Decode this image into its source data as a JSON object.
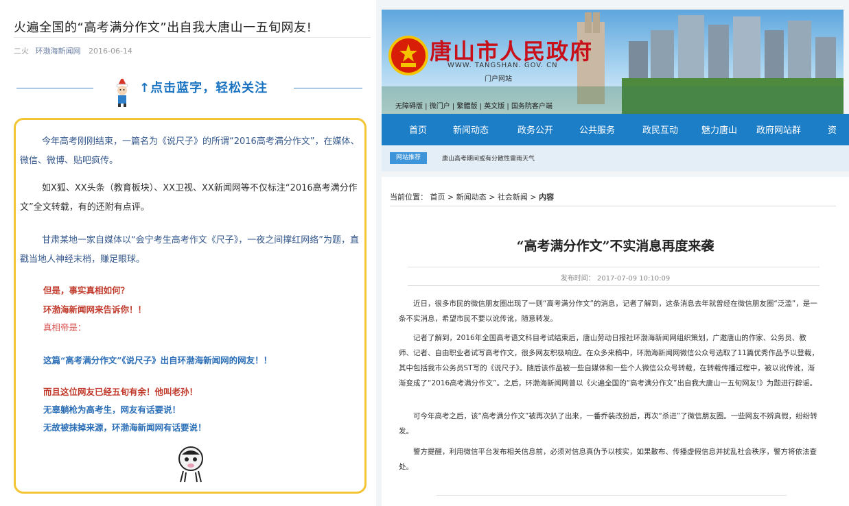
{
  "left": {
    "title": "火遍全国的“高考满分作文”出自我大唐山一五旬网友!",
    "meta": {
      "author": "二火",
      "source": "环渤海新闻网",
      "date": "2016-06-14"
    },
    "follow_text": "↑点击蓝字，轻松关注",
    "paragraphs": [
      "今年高考刚刚结束，一篇名为《说尺子》的所谓“2016高考满分作文”，在媒体、微信、微博、贴吧疯传。",
      "如X狐、XX头条（教育板块）、XX卫视、XX新闻网等不仅标注“2016高考满分作文”全文转载，有的还附有点评。",
      "甘肃某地一家自媒体以“会宁考生高考作文《尺子》，一夜之间撑红网络”为题，直戳当地人神经末梢，赚足眼球。"
    ],
    "red_lines": [
      "但是，事实真相如何？",
      "环渤海新闻网来告诉你！！",
      "真相帝是："
    ],
    "blue_line": "这篇“高考满分作文”《说尺子》出自环渤海新闻网的网友！！",
    "closing_lines": [
      "而且这位网友已经五旬有余！他叫老孙！",
      "无辜躺枪为高考生，网友有话要说！",
      "无故被抹掉来源，环渤海新闻网有话要说！"
    ],
    "colors": {
      "border": "#f3c433",
      "blue_text": "#35588c",
      "red_text": "#c0392b"
    }
  },
  "right": {
    "site_title": "唐山市人民政府",
    "site_url": "WWW. TANGSHAN. GOV. CN",
    "site_sub": "门户网站",
    "top_links": [
      "无障碍版",
      "微门户",
      "繁體版",
      "英文版",
      "国务院客户端"
    ],
    "nav": [
      "首页",
      "新闻动态",
      "政务公开",
      "公共服务",
      "政民互动",
      "魅力唐山",
      "政府网站群",
      "资"
    ],
    "recommend_tag": "网站推荐",
    "recommend_text": "唐山高考期间或有分散性雷雨天气",
    "breadcrumb": {
      "label": "当前位置：",
      "items": [
        "首页",
        "新闻动态",
        "社会新闻",
        "内容"
      ]
    },
    "headline": "“高考满分作文”不实消息再度来袭",
    "publish_time": "发布时间： 2017-07-09 10:10:09",
    "body": [
      "近日，很多市民的微信朋友圈出现了一则“高考满分作文”的消息，记者了解到，这条消息去年就曾经在微信朋友圈“泛滥”，是一条不实消息，希望市民不要以讹传讹，随意转发。",
      "记者了解到，2016年全国高考语文科目考试结束后，唐山劳动日报社环渤海新闻网组织策划，广邀唐山的作家、公务员、教师、记者、自由职业者试写高考作文，很多网友积极响应。在众多来稿中，环渤海新闻网微信公众号选取了11篇优秀作品予以登载，其中包括我市公务员ST写的《说尺子》。随后该作品被一些自媒体和一些个人微信公众号转载，在转载传播过程中，被以讹传讹，渐渐变成了“2016高考满分作文”。之后，环渤海新闻网曾以《火遍全国的“高考满分作文”出自我大唐山一五旬网友!》为题进行辟谣。",
      "可今年高考之后，该“高考满分作文”被再次扒了出来，一番乔装改扮后，再次“杀进”了微信朋友圈。一些网友不辨真假，纷纷转发。",
      "警方提醒，利用微信平台发布相关信息前，必须对信息真伪予以核实，如果散布、传播虚假信息并扰乱社会秩序，警方将依法查处。"
    ],
    "colors": {
      "nav": "#1d7ec8",
      "title_red": "#c8101a"
    }
  }
}
